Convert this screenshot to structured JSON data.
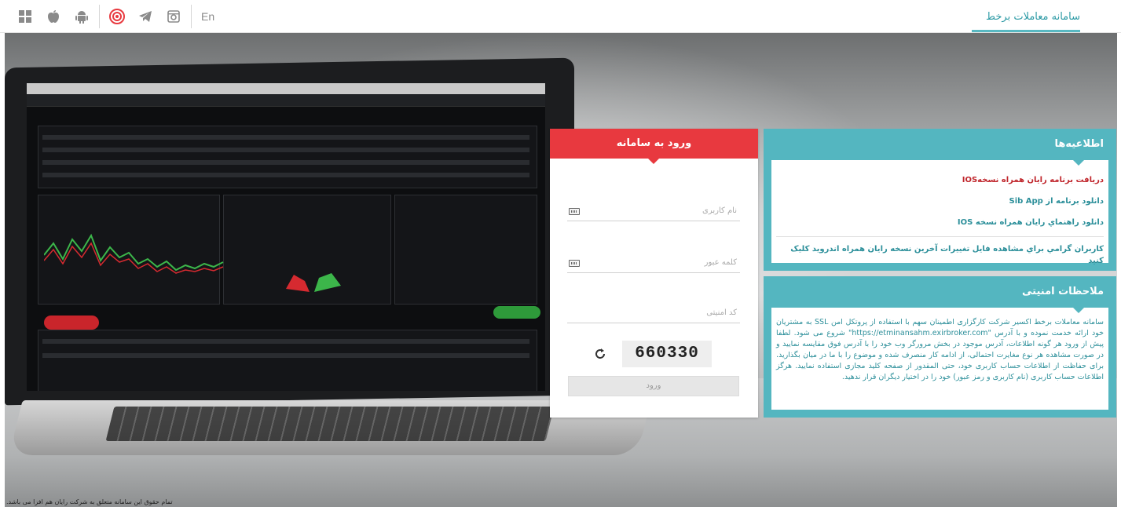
{
  "header": {
    "brand": "سامانه معاملات برخط",
    "language": "En",
    "icons": [
      "windows-icon",
      "apple-icon",
      "android-icon",
      "target-icon",
      "telegram-icon",
      "instagram-icon"
    ]
  },
  "login": {
    "title": "ورود به سامانه",
    "username_placeholder": "نام کاربری",
    "password_placeholder": "کلمه عبور",
    "captcha_placeholder": "کد امنیتی",
    "captcha_value": "660330",
    "submit_label": "ورود"
  },
  "news": {
    "title": "اطلاعیه‌ها",
    "items": [
      "دریافت برنامه رایان همراه نسخهIOS",
      "دانلود برنامه از Sib App",
      "دانلود راهنماي رايان همراه نسخه IOS"
    ],
    "note": "کاربران گرامي براي مشاهده فايل تغييرات آخرين نسخه رايان همراه اندرويد کليک کنيد"
  },
  "security": {
    "title": "ملاحظات امنیتی",
    "body": "سامانه معاملات برخط اکسیر شرکت کارگزاری اطمینان سهم با استفاده از پروتکل امن SSL به مشتریان خود ارائه خدمت نموده و با آدرس \"https://etminansahm.exirbroker.com\" شروع می شود. لطفا پیش از ورود هر گونه اطلاعات، آدرس موجود در بخش مرورگر وب خود را با آدرس فوق مقایسه نمایید و در صورت مشاهده هر نوع مغایرت احتمالی، از ادامه کار منصرف شده و موضوع را با ما در میان بگذارید. برای حفاظت از اطلاعات حساب کاربری خود، حتی المقدور از صفحه کلید مجازی استفاده نمایید. هرگز اطلاعات حساب کاربری (نام کاربری و رمز عبور) خود را در اختیار دیگران قرار ندهید."
  },
  "footer": {
    "note": "تمام حقوق این سامانه متعلق به شرکت رایان هم افزا می باشد."
  },
  "colors": {
    "login_header": "#e8393f",
    "card_accent": "#54b6c0",
    "link_red": "#c0262c",
    "link_teal": "#2c8f9a"
  }
}
